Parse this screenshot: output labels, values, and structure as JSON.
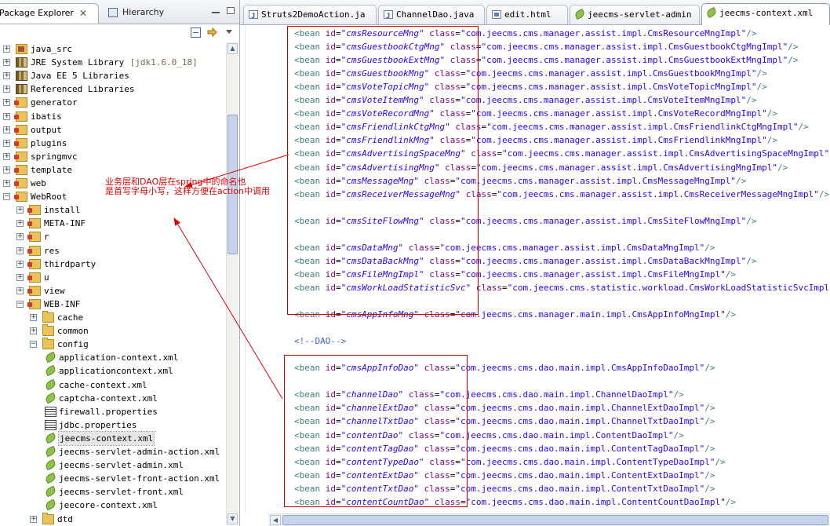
{
  "left_panel": {
    "tabs": [
      {
        "label": "Package Explorer",
        "active": true
      },
      {
        "label": "Hierarchy",
        "active": false
      }
    ],
    "tree": [
      {
        "label": "java_src",
        "indent": 0,
        "expander": "+",
        "icon": "package-folder-icon"
      },
      {
        "label": "JRE System Library",
        "sub": "[jdk1.6.0_18]",
        "indent": 0,
        "expander": "+",
        "icon": "library-icon"
      },
      {
        "label": "Java EE 5 Libraries",
        "indent": 0,
        "expander": "+",
        "icon": "library-icon"
      },
      {
        "label": "Referenced Libraries",
        "indent": 0,
        "expander": "+",
        "icon": "library-icon"
      },
      {
        "label": "generator",
        "indent": 0,
        "expander": "+",
        "icon": "project-folder-icon"
      },
      {
        "label": "ibatis",
        "indent": 0,
        "expander": "+",
        "icon": "project-folder-icon"
      },
      {
        "label": "output",
        "indent": 0,
        "expander": "+",
        "icon": "project-folder-icon"
      },
      {
        "label": "plugins",
        "indent": 0,
        "expander": "+",
        "icon": "project-folder-icon"
      },
      {
        "label": "springmvc",
        "indent": 0,
        "expander": "+",
        "icon": "project-folder-icon"
      },
      {
        "label": "template",
        "indent": 0,
        "expander": "+",
        "icon": "project-folder-icon"
      },
      {
        "label": "web",
        "indent": 0,
        "expander": "+",
        "icon": "project-folder-icon"
      },
      {
        "label": "WebRoot",
        "indent": 0,
        "expander": "-",
        "icon": "project-folder-icon"
      },
      {
        "label": "install",
        "indent": 1,
        "expander": "+",
        "icon": "project-folder-icon"
      },
      {
        "label": "META-INF",
        "indent": 1,
        "expander": "+",
        "icon": "project-folder-icon"
      },
      {
        "label": "r",
        "indent": 1,
        "expander": "+",
        "icon": "project-folder-icon"
      },
      {
        "label": "res",
        "indent": 1,
        "expander": "+",
        "icon": "project-folder-icon"
      },
      {
        "label": "thirdparty",
        "indent": 1,
        "expander": "+",
        "icon": "project-folder-icon"
      },
      {
        "label": "u",
        "indent": 1,
        "expander": "+",
        "icon": "project-folder-icon"
      },
      {
        "label": "view",
        "indent": 1,
        "expander": "+",
        "icon": "project-folder-icon"
      },
      {
        "label": "WEB-INF",
        "indent": 1,
        "expander": "-",
        "icon": "project-folder-icon"
      },
      {
        "label": "cache",
        "indent": 2,
        "expander": "+",
        "icon": "folder-icon"
      },
      {
        "label": "common",
        "indent": 2,
        "expander": "+",
        "icon": "folder-icon"
      },
      {
        "label": "config",
        "indent": 2,
        "expander": "-",
        "icon": "folder-icon"
      },
      {
        "label": "application-context.xml",
        "indent": 3,
        "expander": "",
        "icon": "xml-file-icon"
      },
      {
        "label": "applicationcontext.xml",
        "indent": 3,
        "expander": "",
        "icon": "xml-file-icon"
      },
      {
        "label": "cache-context.xml",
        "indent": 3,
        "expander": "",
        "icon": "xml-file-icon"
      },
      {
        "label": "captcha-context.xml",
        "indent": 3,
        "expander": "",
        "icon": "xml-file-icon"
      },
      {
        "label": "firewall.properties",
        "indent": 3,
        "expander": "",
        "icon": "properties-file-icon"
      },
      {
        "label": "jdbc.properties",
        "indent": 3,
        "expander": "",
        "icon": "properties-file-icon"
      },
      {
        "label": "jeecms-context.xml",
        "indent": 3,
        "expander": "",
        "icon": "xml-file-icon",
        "selected": true
      },
      {
        "label": "jeecms-servlet-admin-action.xml",
        "indent": 3,
        "expander": "",
        "icon": "xml-file-icon"
      },
      {
        "label": "jeecms-servlet-admin.xml",
        "indent": 3,
        "expander": "",
        "icon": "xml-file-icon"
      },
      {
        "label": "jeecms-servlet-front-action.xml",
        "indent": 3,
        "expander": "",
        "icon": "xml-file-icon"
      },
      {
        "label": "jeecms-servlet-front.xml",
        "indent": 3,
        "expander": "",
        "icon": "xml-file-icon"
      },
      {
        "label": "jeecore-context.xml",
        "indent": 3,
        "expander": "",
        "icon": "xml-file-icon"
      },
      {
        "label": "dtd",
        "indent": 2,
        "expander": "+",
        "icon": "folder-icon"
      }
    ]
  },
  "editor": {
    "tabs": [
      {
        "label": "Struts2DemoAction.ja",
        "icon": "java",
        "active": false
      },
      {
        "label": "ChannelDao.java",
        "icon": "java",
        "active": false
      },
      {
        "label": "edit.html",
        "icon": "html",
        "active": false
      },
      {
        "label": "jeecms-servlet-admin",
        "icon": "leaf",
        "active": false
      },
      {
        "label": "jeecms-context.xml",
        "icon": "leaf",
        "active": true
      }
    ],
    "lines": [
      {
        "type": "bean",
        "id": "cmsResourceMng",
        "cls": "com.jeecms.cms.manager.assist.impl.CmsResourceMngImpl\"/>"
      },
      {
        "type": "bean",
        "id": "cmsGuestbookCtgMng",
        "cls": "com.jeecms.cms.manager.assist.impl.CmsGuestbookCtgMngImpl\"/>"
      },
      {
        "type": "bean",
        "id": "cmsGuestbookExtMng",
        "cls": "com.jeecms.cms.manager.assist.impl.CmsGuestbookExtMngImpl\"/>"
      },
      {
        "type": "bean",
        "id": "cmsGuestbookMng",
        "cls": "com.jeecms.cms.manager.assist.impl.CmsGuestbookMngImpl\"/>"
      },
      {
        "type": "bean",
        "id": "cmsVoteTopicMng",
        "cls": "com.jeecms.cms.manager.assist.impl.CmsVoteTopicMngImpl\"/>"
      },
      {
        "type": "bean",
        "id": "cmsVoteItemMng",
        "cls": "com.jeecms.cms.manager.assist.impl.CmsVoteItemMngImpl\"/>"
      },
      {
        "type": "bean",
        "id": "cmsVoteRecordMng",
        "cls": "com.jeecms.cms.manager.assist.impl.CmsVoteRecordMngImpl\"/>"
      },
      {
        "type": "bean",
        "id": "cmsFriendlinkCtgMng",
        "cls": "com.jeecms.cms.manager.assist.impl.CmsFriendlinkCtgMngImpl\"/>"
      },
      {
        "type": "bean",
        "id": "cmsFriendlinkMng",
        "cls": "com.jeecms.cms.manager.assist.impl.CmsFriendlinkMngImpl\"/>"
      },
      {
        "type": "bean",
        "id": "cmsAdvertisingSpaceMng",
        "cls": "com.jeecms.cms.manager.assist.impl.CmsAdvertisingSpaceMngImpl\"/>"
      },
      {
        "type": "bean",
        "id": "cmsAdvertisingMng",
        "cls": "com.jeecms.cms.manager.assist.impl.CmsAdvertisingMngImpl\"/>"
      },
      {
        "type": "bean",
        "id": "cmsMessageMng",
        "cls": "com.jeecms.cms.manager.assist.impl.CmsMessageMngImpl\"/>"
      },
      {
        "type": "bean",
        "id": "cmsReceiverMessageMng",
        "cls": "com.jeecms.cms.manager.assist.impl.CmsReceiverMessageMngImpl\"/>"
      },
      {
        "type": "blank"
      },
      {
        "type": "bean",
        "id": "cmsSiteFlowMng",
        "cls": "com.jeecms.cms.manager.assist.impl.CmsSiteFlowMngImpl\"/>"
      },
      {
        "type": "blank"
      },
      {
        "type": "bean",
        "id": "cmsDataMng",
        "cls": "com.jeecms.cms.manager.assist.impl.CmsDataMngImpl\"/>"
      },
      {
        "type": "bean",
        "id": "cmsDataBackMng",
        "cls": "com.jeecms.cms.manager.assist.impl.CmsDataBackMngImpl\"/>"
      },
      {
        "type": "bean",
        "id": "cmsFileMngImpl",
        "cls": "com.jeecms.cms.manager.assist.impl.CmsFileMngImpl\"/>"
      },
      {
        "type": "bean",
        "id": "cmsWorkLoadStatisticSvc",
        "cls": "com.jeecms.cms.statistic.workload.CmsWorkLoadStatisticSvcImpl\"/>"
      },
      {
        "type": "blank"
      },
      {
        "type": "bean",
        "id": "cmsAppInfoMng",
        "cls": "com.jeecms.cms.manager.main.impl.CmsAppInfoMngImpl\"/>"
      },
      {
        "type": "blank"
      },
      {
        "type": "comment",
        "text": "<!--DAO-->"
      },
      {
        "type": "blank"
      },
      {
        "type": "bean",
        "id": "cmsAppInfoDao",
        "cls": "com.jeecms.cms.dao.main.impl.CmsAppInfoDaoImpl\"/>"
      },
      {
        "type": "blank"
      },
      {
        "type": "bean",
        "id": "channelDao",
        "cls": "com.jeecms.cms.dao.main.impl.ChannelDaoImpl\"/>"
      },
      {
        "type": "bean",
        "id": "channelExtDao",
        "cls": "com.jeecms.cms.dao.main.impl.ChannelExtDaoImpl\"/>"
      },
      {
        "type": "bean",
        "id": "channelTxtDao",
        "cls": "com.jeecms.cms.dao.main.impl.ChannelTxtDaoImpl\"/>"
      },
      {
        "type": "bean",
        "id": "contentDao",
        "cls": "com.jeecms.cms.dao.main.impl.ContentDaoImpl\"/>"
      },
      {
        "type": "bean",
        "id": "contentTagDao",
        "cls": "com.jeecms.cms.dao.main.impl.ContentTagDaoImpl\"/>"
      },
      {
        "type": "bean",
        "id": "contentTypeDao",
        "cls": "com.jeecms.cms.dao.main.impl.ContentTypeDaoImpl\"/>"
      },
      {
        "type": "bean",
        "id": "contentExtDao",
        "cls": "com.jeecms.cms.dao.main.impl.ContentExtDaoImpl\"/>"
      },
      {
        "type": "bean",
        "id": "contentTxtDao",
        "cls": "com.jeecms.cms.dao.main.impl.ContentTxtDaoImpl\"/>"
      },
      {
        "type": "bean",
        "id": "contentCountDao",
        "cls": "com.jeecms.cms.dao.main.impl.ContentCountDaoImpl\"/>"
      }
    ]
  },
  "annotation": {
    "line1": "业务层和DAO层在spring中的命名也",
    "line2": "是首写字母小写，这样方便在action中调用",
    "color": "#e00000"
  },
  "colors": {
    "xml_tag": "#3f7f7f",
    "xml_attr": "#7f007f",
    "xml_value": "#2a00ff",
    "xml_comment": "#3f5fbf"
  }
}
